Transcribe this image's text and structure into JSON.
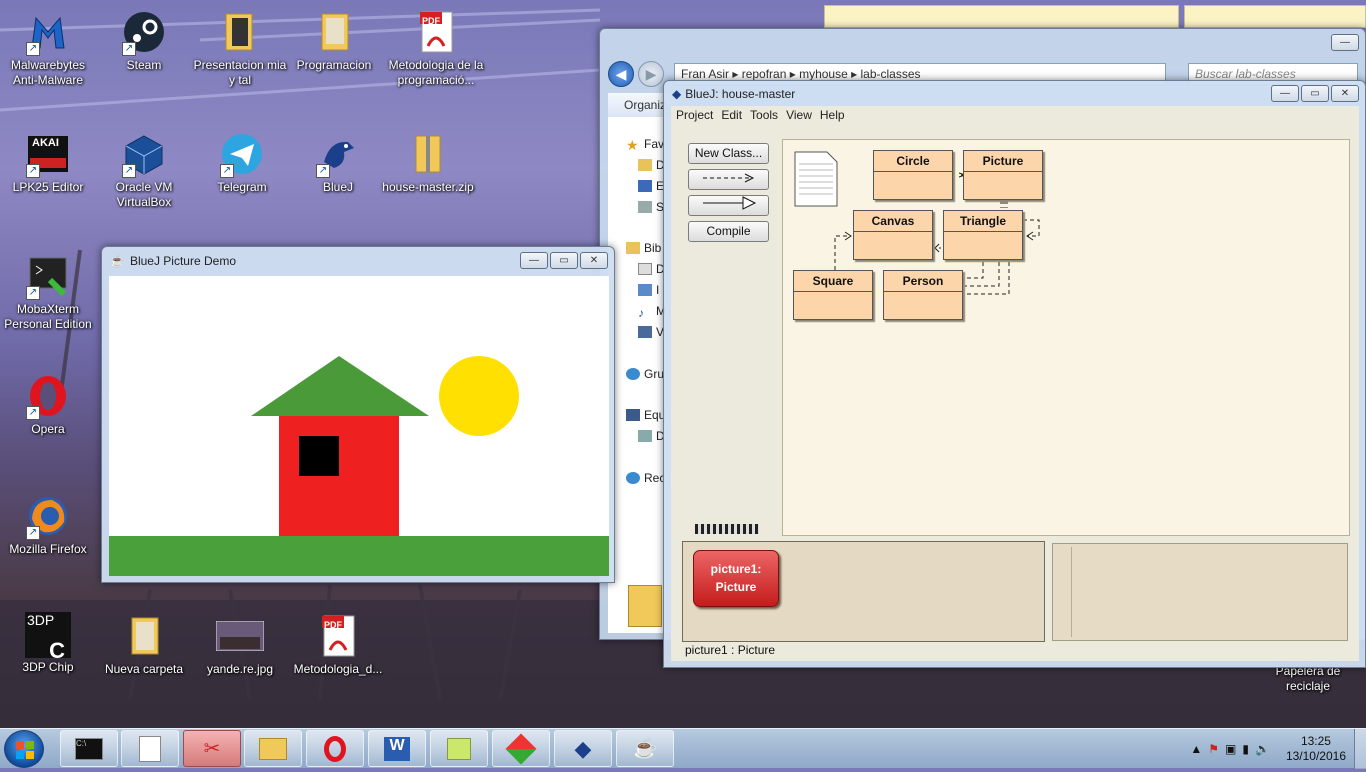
{
  "desktop": {
    "icons": [
      {
        "label": "Malwarebytes Anti-Malware",
        "icon": "malwarebytes-icon"
      },
      {
        "label": "Steam",
        "icon": "steam-icon"
      },
      {
        "label": "Presentacion mia y tal",
        "icon": "folder-icon"
      },
      {
        "label": "Programacion",
        "icon": "folder-icon"
      },
      {
        "label": "Metodologia de la programació...",
        "icon": "pdf-icon"
      },
      {
        "label": "LPK25 Editor",
        "icon": "akai-icon"
      },
      {
        "label": "Oracle VM VirtualBox",
        "icon": "virtualbox-icon"
      },
      {
        "label": "Telegram",
        "icon": "telegram-icon"
      },
      {
        "label": "BlueJ",
        "icon": "bluej-icon"
      },
      {
        "label": "house-master.zip",
        "icon": "zip-folder-icon"
      },
      {
        "label": "MobaXterm Personal Edition",
        "icon": "mobaxterm-icon"
      },
      {
        "label": "Opera",
        "icon": "opera-icon"
      },
      {
        "label": "Mozilla Firefox",
        "icon": "firefox-icon"
      },
      {
        "label": "3DP Chip",
        "icon": "3dp-chip-icon"
      },
      {
        "label": "Nueva carpeta",
        "icon": "folder-icon"
      },
      {
        "label": "yande.re.jpg",
        "icon": "image-icon"
      },
      {
        "label": "Metodologia_d...",
        "icon": "pdf-icon"
      },
      {
        "label": "Papelera de reciclaje",
        "icon": "recycle-bin-icon"
      }
    ],
    "pdf_badge": "PDF",
    "akai_text": "AKAI",
    "tdp_text": "3DP"
  },
  "explorer": {
    "address": "Fran Asir  ▸  repofran  ▸  myhouse  ▸  lab-classes",
    "search_placeholder": "Buscar lab-classes",
    "organize": "Organiz",
    "nav_items": [
      "Fav",
      "D",
      "E",
      "S",
      "Bib",
      "D",
      "I",
      "M",
      "V",
      "Gru",
      "Equ",
      "D",
      "Rec"
    ]
  },
  "bluej": {
    "title": "BlueJ:  house-master",
    "menu": [
      "Project",
      "Edit",
      "Tools",
      "View",
      "Help"
    ],
    "buttons": {
      "new_class": "New Class...",
      "compile": "Compile"
    },
    "classes": [
      "Circle",
      "Picture",
      "Canvas",
      "Triangle",
      "Square",
      "Person"
    ],
    "object": {
      "line1": "picture1:",
      "line2": "Picture"
    },
    "status": "picture1 : Picture",
    "colors": {
      "class_fill": "#fcd5ab",
      "object_fill": "#d32a2a",
      "diagram_bg": "#faf4e4"
    }
  },
  "picture_demo": {
    "title": "BlueJ Picture Demo",
    "colors": {
      "ground": "#4aa03a",
      "roof": "#4a9a3a",
      "wall": "#ee2020",
      "window": "#000000",
      "sun": "#ffe000"
    }
  },
  "taskbar": {
    "items": [
      "cmd-icon",
      "bluej-doc-icon",
      "snipping-tool-icon",
      "explorer-icon",
      "opera-icon",
      "word-icon",
      "sticky-notes-icon",
      "app-icon",
      "bluej-icon",
      "java-icon"
    ],
    "word_letter": "W",
    "clock_time": "13:25",
    "clock_date": "13/10/2016"
  }
}
